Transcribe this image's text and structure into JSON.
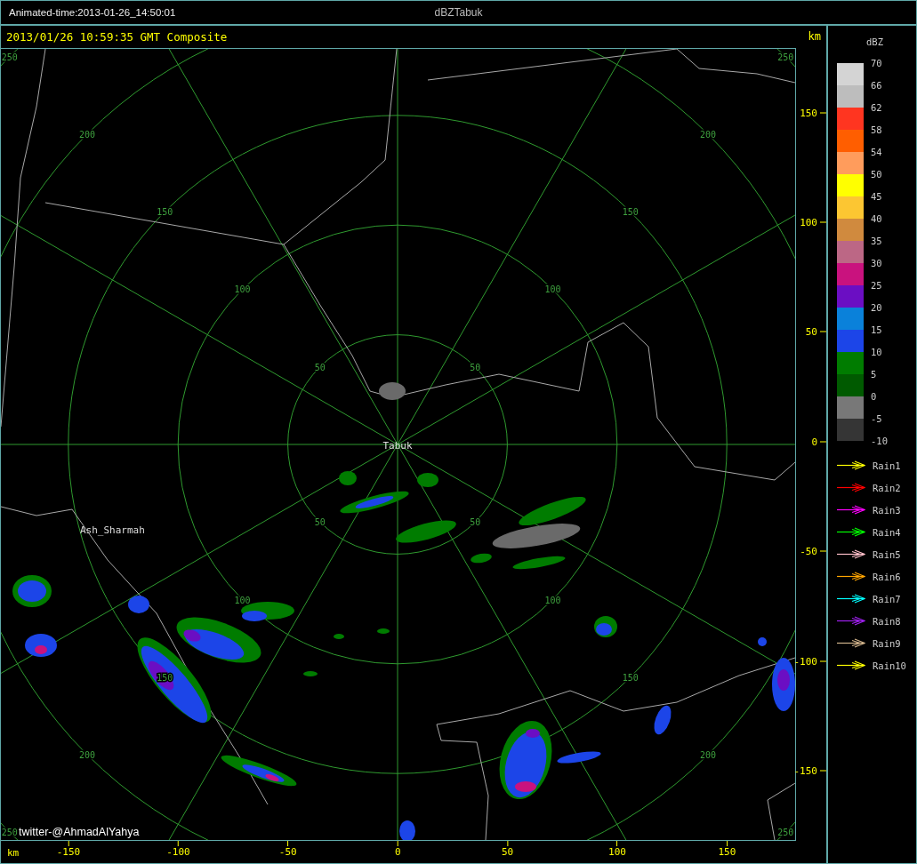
{
  "title_bar": {
    "animated_time": "Animated-time:2013-01-26_14:50:01",
    "title": "dBZTabuk"
  },
  "header": {
    "timestamp": "2013/01/26 10:59:35 GMT Composite"
  },
  "radar": {
    "rings": [
      {
        "labels": [
          "50",
          "50",
          "50",
          "50"
        ]
      },
      {
        "labels": [
          "100",
          "100",
          "100",
          "100"
        ]
      },
      {
        "labels": [
          "150",
          "150",
          "150",
          "150"
        ]
      },
      {
        "labels": [
          "200",
          "200",
          "200",
          "200"
        ]
      },
      {
        "labels": [
          "250",
          "250",
          "250",
          "250"
        ]
      }
    ],
    "places": [
      {
        "name": "Tabuk"
      },
      {
        "name": "Ash_Sharmah"
      }
    ],
    "credit": "twitter-@AhmadAlYahya"
  },
  "right_axis": {
    "unit": "km",
    "ticks": [
      "150",
      "100",
      "50",
      "0",
      "-50",
      "-100",
      "-150"
    ]
  },
  "bottom_axis": {
    "unit": "km",
    "ticks": [
      "-150",
      "-100",
      "-50",
      "0",
      "50",
      "100",
      "150"
    ]
  },
  "legend": {
    "title": "dBZ",
    "labels": [
      "70",
      "66",
      "62",
      "58",
      "54",
      "50",
      "45",
      "40",
      "35",
      "30",
      "25",
      "20",
      "15",
      "10",
      "5",
      "0",
      "-5",
      "-10"
    ],
    "bins": [
      {
        "color": "#d4d4d4"
      },
      {
        "color": "#bdbdbd"
      },
      {
        "color": "#ff3520"
      },
      {
        "color": "#ff5e00"
      },
      {
        "color": "#ff9c5c"
      },
      {
        "color": "#ffff00"
      },
      {
        "color": "#fcc632"
      },
      {
        "color": "#d08a3e"
      },
      {
        "color": "#bc6785"
      },
      {
        "color": "#c9127e"
      },
      {
        "color": "#6b0ec3"
      },
      {
        "color": "#0a81da"
      },
      {
        "color": "#1c45e8"
      },
      {
        "color": "#007c00"
      },
      {
        "color": "#005a00"
      },
      {
        "color": "#787878"
      },
      {
        "color": "#353535"
      }
    ]
  },
  "rain_legend": [
    {
      "name": "Rain1",
      "color": "#ffff00"
    },
    {
      "name": "Rain2",
      "color": "#ff0000"
    },
    {
      "name": "Rain3",
      "color": "#ff00ff"
    },
    {
      "name": "Rain4",
      "color": "#00ff00"
    },
    {
      "name": "Rain5",
      "color": "#ffc0cb"
    },
    {
      "name": "Rain6",
      "color": "#ffa500"
    },
    {
      "name": "Rain7",
      "color": "#00ffff"
    },
    {
      "name": "Rain8",
      "color": "#a020f0"
    },
    {
      "name": "Rain9",
      "color": "#d2b48c"
    },
    {
      "name": "Rain10",
      "color": "#ffff00"
    }
  ]
}
